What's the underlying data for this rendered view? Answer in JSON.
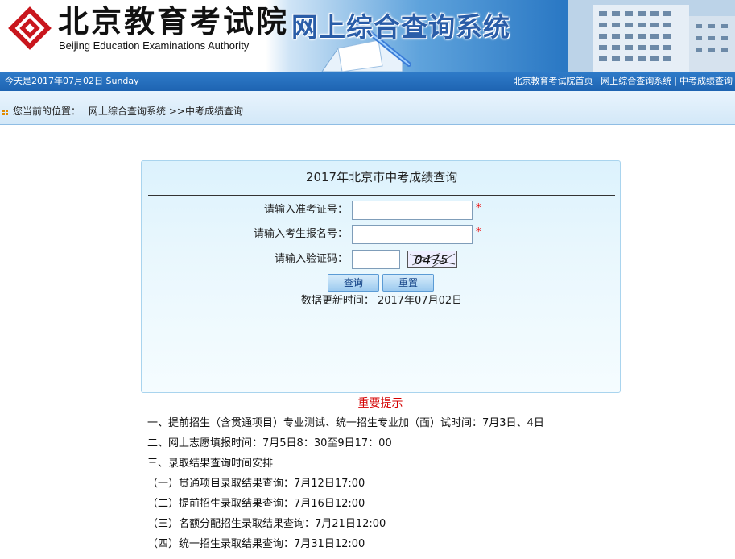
{
  "header": {
    "org_cn": "北京教育考试院",
    "org_en": "Beijing Education Examinations Authority",
    "system_title": "网上综合查询系统",
    "brand_red": "#c9161d",
    "brand_blue": "#2a5da8"
  },
  "topbar": {
    "date": "今天是2017年07月02日  Sunday",
    "links": [
      "北京教育考试院首页",
      "网上综合查询系统",
      "中考成绩查询"
    ],
    "separator": "|"
  },
  "breadcrumb": {
    "label": "您当前的位置：",
    "path": "网上综合查询系统 >>中考成绩查询"
  },
  "query": {
    "title": "2017年北京市中考成绩查询",
    "fields": [
      {
        "label": "请输入准考证号：",
        "value": "",
        "required": "*"
      },
      {
        "label": "请输入考生报名号：",
        "value": "",
        "required": "*"
      },
      {
        "label": "请输入验证码：",
        "value": ""
      }
    ],
    "captcha_text": "0475",
    "submit_label": "查询",
    "reset_label": "重置",
    "updated": "数据更新时间：  2017年07月02日"
  },
  "notice": {
    "title": "重要提示",
    "lines": [
      "一、提前招生（含贯通项目）专业测试、统一招生专业加（面）试时间：7月3日、4日",
      "二、网上志愿填报时间：7月5日8：30至9日17：00",
      "三、录取结果查询时间安排",
      "（一）贯通项目录取结果查询：7月12日17:00",
      "（二）提前招生录取结果查询：7月16日12:00",
      "（三）名额分配招生录取结果查询：7月21日12:00",
      "（四）统一招生录取结果查询：7月31日12:00"
    ]
  }
}
